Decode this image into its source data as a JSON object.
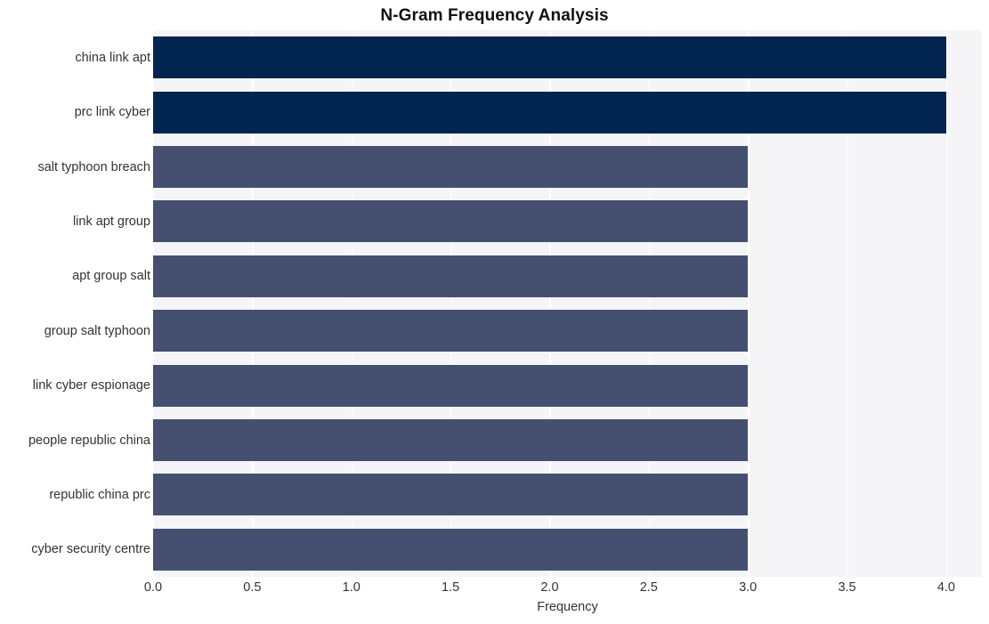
{
  "chart_data": {
    "type": "bar",
    "orientation": "horizontal",
    "title": "N-Gram Frequency Analysis",
    "xlabel": "Frequency",
    "ylabel": "",
    "categories": [
      "china link apt",
      "prc link cyber",
      "salt typhoon breach",
      "link apt group",
      "apt group salt",
      "group salt typhoon",
      "link cyber espionage",
      "people republic china",
      "republic china prc",
      "cyber security centre"
    ],
    "values": [
      4,
      4,
      3,
      3,
      3,
      3,
      3,
      3,
      3,
      3
    ],
    "bar_colors": [
      "#022550",
      "#022550",
      "#455071",
      "#455071",
      "#455071",
      "#455071",
      "#455071",
      "#455071",
      "#455071",
      "#455071"
    ],
    "xlim": [
      0.0,
      4.18
    ],
    "xticks": [
      0.0,
      0.5,
      1.0,
      1.5,
      2.0,
      2.5,
      3.0,
      3.5,
      4.0
    ],
    "xtick_labels": [
      "0.0",
      "0.5",
      "1.0",
      "1.5",
      "2.0",
      "2.5",
      "3.0",
      "3.5",
      "4.0"
    ],
    "grid": true,
    "grid_axis": "x",
    "grid_color": "#ffffff",
    "plot_background": "#f5f5f7",
    "figure_background": "#ffffff",
    "legend": null,
    "legend_position": "none"
  }
}
